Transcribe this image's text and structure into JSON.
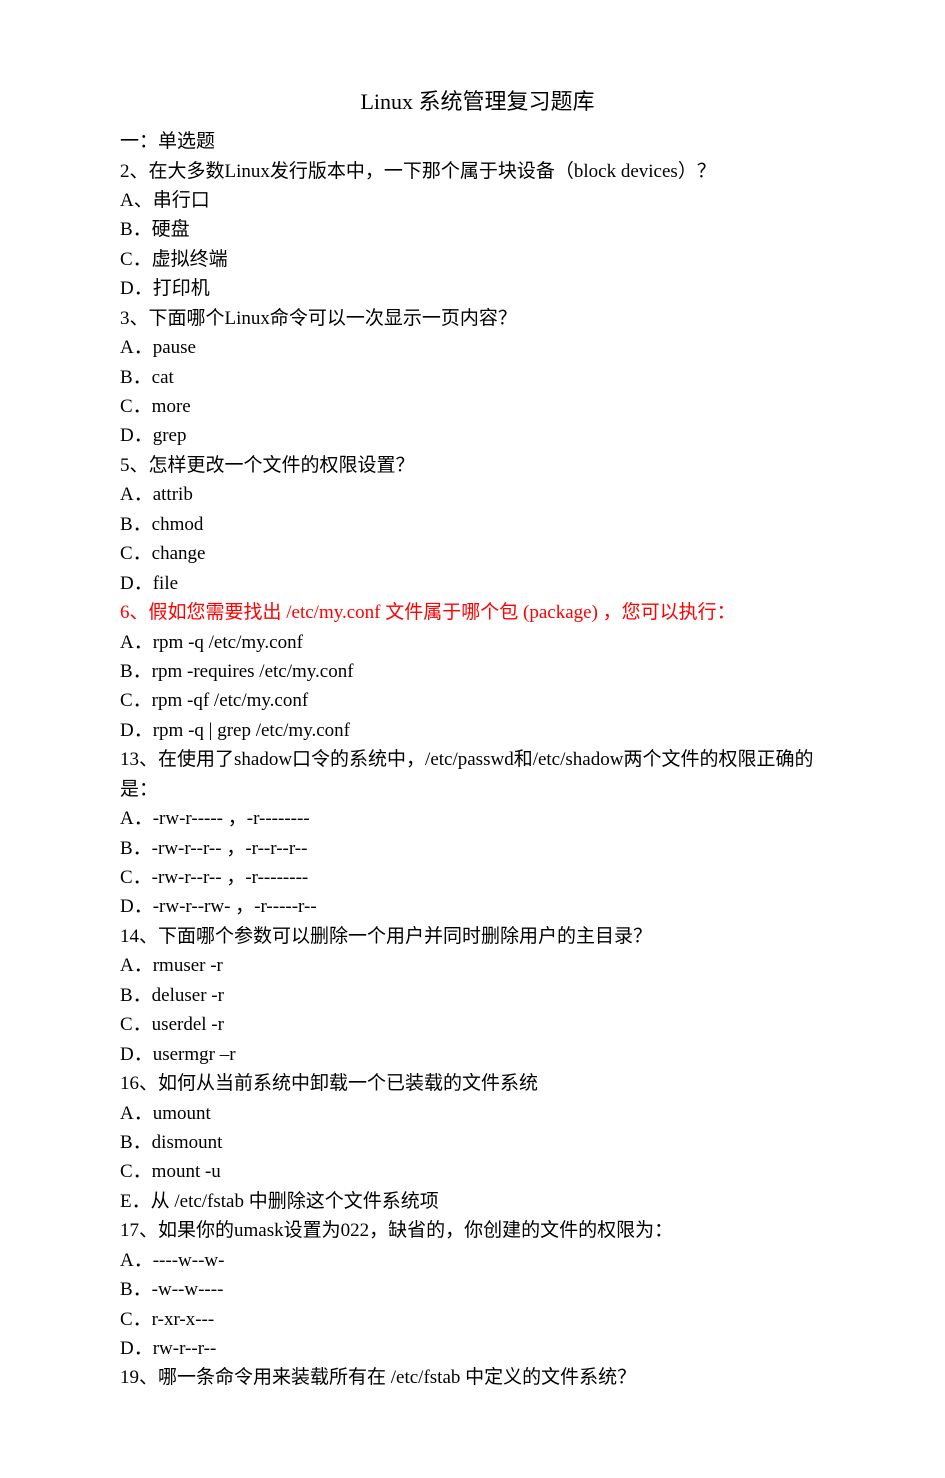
{
  "title": "Linux 系统管理复习题库",
  "section_heading": "一：单选题",
  "q2": {
    "text": "2、在大多数Linux发行版本中，一下那个属于块设备（block devices）？",
    "A": "A、串行口",
    "B": "B．硬盘",
    "C": "C．虚拟终端",
    "D": "D．打印机"
  },
  "q3": {
    "text": "3、下面哪个Linux命令可以一次显示一页内容？",
    "A": "A．pause",
    "B": "B．cat",
    "C": "C．more",
    "D": "D．grep"
  },
  "q5": {
    "text": "5、怎样更改一个文件的权限设置？",
    "A": "A．attrib",
    "B": "B．chmod",
    "C": "C．change",
    "D": "D．file"
  },
  "q6": {
    "text": "6、假如您需要找出 /etc/my.conf  文件属于哪个包 (package) ，您可以执行：",
    "A": "A．rpm  -q  /etc/my.conf",
    "B": "B．rpm  -requires  /etc/my.conf",
    "C": "C．rpm  -qf  /etc/my.conf",
    "D": "D．rpm  -q  |  grep  /etc/my.conf"
  },
  "q13": {
    "text": "13、在使用了shadow口令的系统中，/etc/passwd和/etc/shadow两个文件的权限正确的是：",
    "A": "A．-rw-r----- ，-r--------",
    "B": "B．-rw-r--r-- ，-r--r--r--",
    "C": "C．-rw-r--r-- ，-r--------",
    "D": "D．-rw-r--rw- ，-r-----r--"
  },
  "q14": {
    "text": "14、下面哪个参数可以删除一个用户并同时删除用户的主目录？",
    "A": "A．rmuser  -r",
    "B": "B．deluser  -r",
    "C": "C．userdel  -r",
    "D": "D．usermgr  –r"
  },
  "q16": {
    "text": "16、如何从当前系统中卸载一个已装载的文件系统",
    "A": "A．umount",
    "B": "B．dismount",
    "C": "C．mount  -u",
    "E": "E．从 /etc/fstab  中删除这个文件系统项"
  },
  "q17": {
    "text": "17、如果你的umask设置为022，缺省的，你创建的文件的权限为：",
    "A": "A．----w--w-",
    "B": "B．-w--w----",
    "C": "C．r-xr-x---",
    "D": "D．rw-r--r--"
  },
  "q19": {
    "text": "19、哪一条命令用来装载所有在 /etc/fstab  中定义的文件系统？"
  }
}
